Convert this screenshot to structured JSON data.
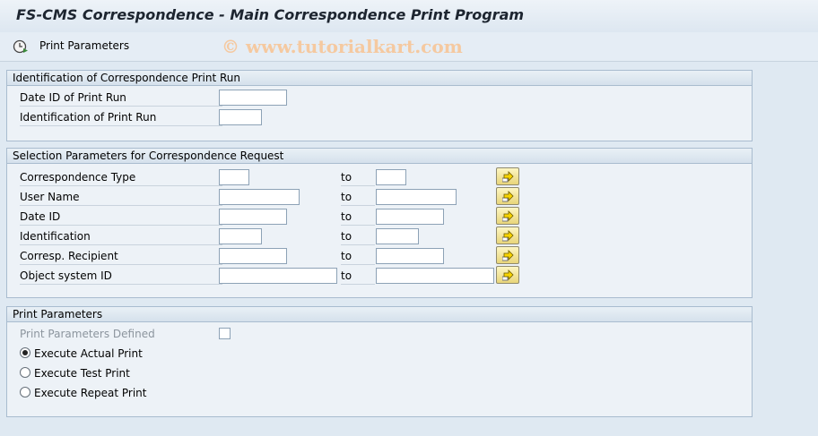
{
  "window": {
    "title": "FS-CMS Correspondence - Main Correspondence Print Program"
  },
  "toolbar": {
    "print_parameters_label": "Print Parameters",
    "print_parameters_icon": "execute-clock-icon"
  },
  "watermark": "© www.tutorialkart.com",
  "section_print_run": {
    "title": "Identification of Correspondence Print Run",
    "fields": [
      {
        "label": "Date ID of Print Run",
        "value": ""
      },
      {
        "label": "Identification of Print Run",
        "value": ""
      }
    ]
  },
  "section_selection": {
    "title": "Selection Parameters for Correspondence Request",
    "to_label": "to",
    "multiple_selection_icon": "multiple-selection-arrow-icon",
    "rows": [
      {
        "label": "Correspondence Type",
        "from": "",
        "to": ""
      },
      {
        "label": "User Name",
        "from": "",
        "to": ""
      },
      {
        "label": "Date ID",
        "from": "",
        "to": ""
      },
      {
        "label": "Identification",
        "from": "",
        "to": ""
      },
      {
        "label": "Corresp. Recipient",
        "from": "",
        "to": ""
      },
      {
        "label": "Object system ID",
        "from": "",
        "to": ""
      }
    ]
  },
  "section_print_params": {
    "title": "Print Parameters",
    "defined_label": "Print Parameters Defined",
    "defined_checked": false,
    "options": [
      {
        "label": "Execute Actual Print",
        "selected": true
      },
      {
        "label": "Execute Test Print",
        "selected": false
      },
      {
        "label": "Execute Repeat Print",
        "selected": false
      }
    ]
  },
  "colors": {
    "background": "#dfe9f2",
    "panel": "#edf2f7",
    "panel_border": "#a9bccf",
    "watermark": "#f5c9a0",
    "button_yellow": "#f3e39a"
  }
}
